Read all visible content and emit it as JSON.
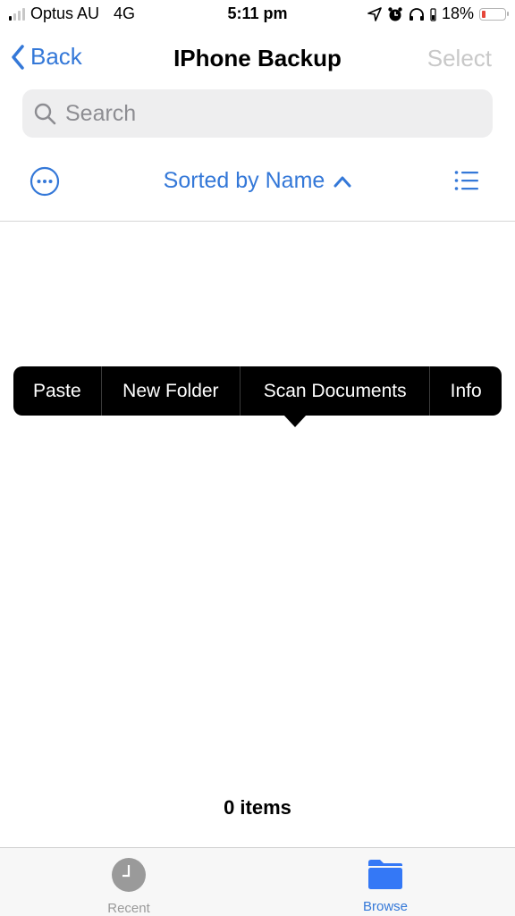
{
  "status_bar": {
    "carrier": "Optus AU",
    "network": "4G",
    "time": "5:11 pm",
    "battery_percent_text": "18%",
    "battery_level": 0.18,
    "signal_bars_active": 1,
    "signal_bars_total": 4,
    "icons": [
      "location-arrow-icon",
      "alarm-icon",
      "headphones-icon",
      "battery-icon"
    ]
  },
  "navbar": {
    "back_label": "Back",
    "title": "IPhone Backup",
    "select_label": "Select"
  },
  "search": {
    "placeholder": "Search",
    "value": ""
  },
  "sort_bar": {
    "sort_label": "Sorted by Name",
    "sort_direction": "ascending"
  },
  "context_menu": {
    "items": [
      {
        "label": "Paste"
      },
      {
        "label": "New Folder"
      },
      {
        "label": "Scan Documents"
      },
      {
        "label": "Info"
      }
    ]
  },
  "content": {
    "item_count": "0 items"
  },
  "tab_bar": {
    "tabs": [
      {
        "label": "Recent",
        "icon": "clock-icon",
        "active": false
      },
      {
        "label": "Browse",
        "icon": "folder-icon",
        "active": true
      }
    ]
  },
  "colors": {
    "accent": "#3478d8",
    "disabled": "#c8c8c8",
    "menu_bg": "#000000",
    "battery_low": "#e5463a"
  }
}
